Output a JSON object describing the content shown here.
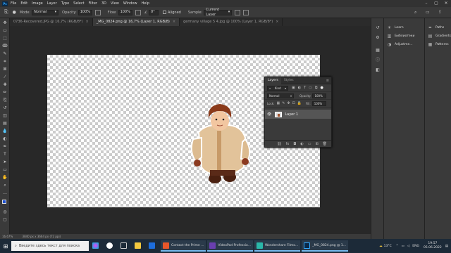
{
  "menubar": {
    "logo": "Ps",
    "items": [
      "File",
      "Edit",
      "Image",
      "Layer",
      "Type",
      "Select",
      "Filter",
      "3D",
      "View",
      "Window",
      "Help"
    ],
    "controls": [
      "–",
      "▢",
      "✕"
    ]
  },
  "options": {
    "mode_label": "Mode:",
    "mode_value": "Normal",
    "opacity_label": "Opacity:",
    "opacity_value": "100%",
    "flow_label": "Flow:",
    "flow_value": "100%",
    "angle_value": "0°",
    "aligned_label": "Aligned",
    "sample_label": "Sample:",
    "sample_value": "Current Layer"
  },
  "tabs": [
    {
      "label": "0736-Recovered.JPG @ 16,7% (RGB/8*)",
      "active": false
    },
    {
      "label": "_MG_0824.png @ 16,7% (Layer 1, RGB/8)",
      "active": true
    },
    {
      "label": "germany village 5 4.jpg @ 100% (Layer 1, RGB/8*)",
      "active": false
    }
  ],
  "status": {
    "zoom": "16,67%",
    "doc": "3840 px x 3664 px (72 ppi)"
  },
  "right_panels": {
    "col1": [
      "Learn",
      "Библиотеки",
      "Adjustme..."
    ],
    "col2": [
      "Paths",
      "Gradients",
      "Patterns"
    ]
  },
  "layers_panel": {
    "tabs": [
      "Layers",
      "Styles"
    ],
    "kind_label": "Kind",
    "blend_mode": "Normal",
    "opacity_label": "Opacity:",
    "opacity_value": "100%",
    "lock_label": "Lock:",
    "fill_label": "Fill:",
    "fill_value": "100%",
    "layer_name": "Layer 1",
    "bottom_icons": [
      "fx-icon",
      "mask-icon",
      "adjustment-icon",
      "group-icon",
      "new-layer-icon",
      "trash-icon"
    ]
  },
  "taskbar": {
    "search_placeholder": "Введите здесь текст для поиска",
    "apps": [
      {
        "label": "Contact the Prime ...",
        "open": true,
        "color": "#e8562a"
      },
      {
        "label": "VideoPad Professio...",
        "open": true,
        "color": "#6a3fb0"
      },
      {
        "label": "Wondershare Filmo...",
        "open": true,
        "color": "#2ab7a9"
      },
      {
        "label": "_MG_0824.png @ 1...",
        "open": true,
        "color": "#0a2a4a"
      }
    ],
    "weather": "13°C",
    "lang": "ENG",
    "time": "19:57",
    "date": "05.06.2022"
  },
  "colors": {
    "accent": "#31a8ff",
    "canvas_check": "#cccccc"
  }
}
